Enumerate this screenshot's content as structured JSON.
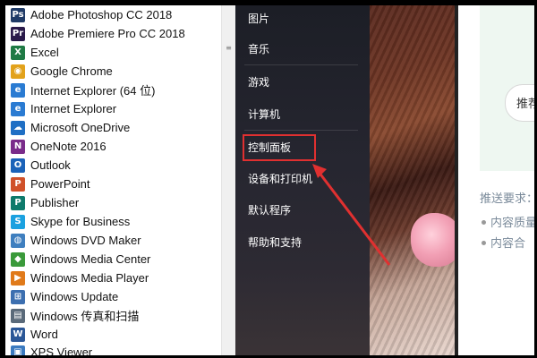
{
  "programs": [
    {
      "label": "Adobe Photoshop CC 2018",
      "icon": "photoshop-icon",
      "glyph": "Ps",
      "color": "#1f3a66"
    },
    {
      "label": "Adobe Premiere Pro CC 2018",
      "icon": "premiere-icon",
      "glyph": "Pr",
      "color": "#2a1a4a"
    },
    {
      "label": "Excel",
      "icon": "excel-icon",
      "glyph": "X",
      "color": "#1f7a45"
    },
    {
      "label": "Google Chrome",
      "icon": "chrome-icon",
      "glyph": "◉",
      "color": "#e2a21b"
    },
    {
      "label": "Internet Explorer (64 位)",
      "icon": "internet-explorer-icon",
      "glyph": "e",
      "color": "#2a7bd2"
    },
    {
      "label": "Internet Explorer",
      "icon": "internet-explorer-icon",
      "glyph": "e",
      "color": "#2a7bd2"
    },
    {
      "label": "Microsoft OneDrive",
      "icon": "onedrive-icon",
      "glyph": "☁",
      "color": "#1f6fc4"
    },
    {
      "label": "OneNote 2016",
      "icon": "onenote-icon",
      "glyph": "N",
      "color": "#7a2c8a"
    },
    {
      "label": "Outlook",
      "icon": "outlook-icon",
      "glyph": "O",
      "color": "#1b62b8"
    },
    {
      "label": "PowerPoint",
      "icon": "powerpoint-icon",
      "glyph": "P",
      "color": "#d0512a"
    },
    {
      "label": "Publisher",
      "icon": "publisher-icon",
      "glyph": "P",
      "color": "#0e7a6b"
    },
    {
      "label": "Skype for Business",
      "icon": "skype-icon",
      "glyph": "S",
      "color": "#1aa1e0"
    },
    {
      "label": "Windows DVD Maker",
      "icon": "dvd-maker-icon",
      "glyph": "◍",
      "color": "#3f7fbf"
    },
    {
      "label": "Windows Media Center",
      "icon": "media-center-icon",
      "glyph": "◆",
      "color": "#3a9a3a"
    },
    {
      "label": "Windows Media Player",
      "icon": "media-player-icon",
      "glyph": "▶",
      "color": "#e07a1a"
    },
    {
      "label": "Windows Update",
      "icon": "windows-update-icon",
      "glyph": "⊞",
      "color": "#3c6fb0"
    },
    {
      "label": "Windows 传真和扫描",
      "icon": "fax-scan-icon",
      "glyph": "▤",
      "color": "#5a6a7a"
    },
    {
      "label": "Word",
      "icon": "word-icon",
      "glyph": "W",
      "color": "#2b5797"
    },
    {
      "label": "XPS Viewer",
      "icon": "xps-viewer-icon",
      "glyph": "▣",
      "color": "#3a7ac0"
    }
  ],
  "right_menu": [
    {
      "label": "图片",
      "key": "pictures"
    },
    {
      "label": "音乐",
      "key": "music"
    },
    {
      "label": "游戏",
      "key": "games"
    },
    {
      "label": "计算机",
      "key": "computer"
    },
    {
      "label": "控制面板",
      "key": "control-panel"
    },
    {
      "label": "设备和打印机",
      "key": "devices-printers"
    },
    {
      "label": "默认程序",
      "key": "default-programs"
    },
    {
      "label": "帮助和支持",
      "key": "help-support"
    }
  ],
  "web": {
    "pill_text": "推荐",
    "requirements_label": "推送要求：",
    "bullet1": "内容质量",
    "bullet2": "内容合"
  },
  "colors": {
    "highlight": "#e03030",
    "accent_green": "#eef7f1"
  }
}
